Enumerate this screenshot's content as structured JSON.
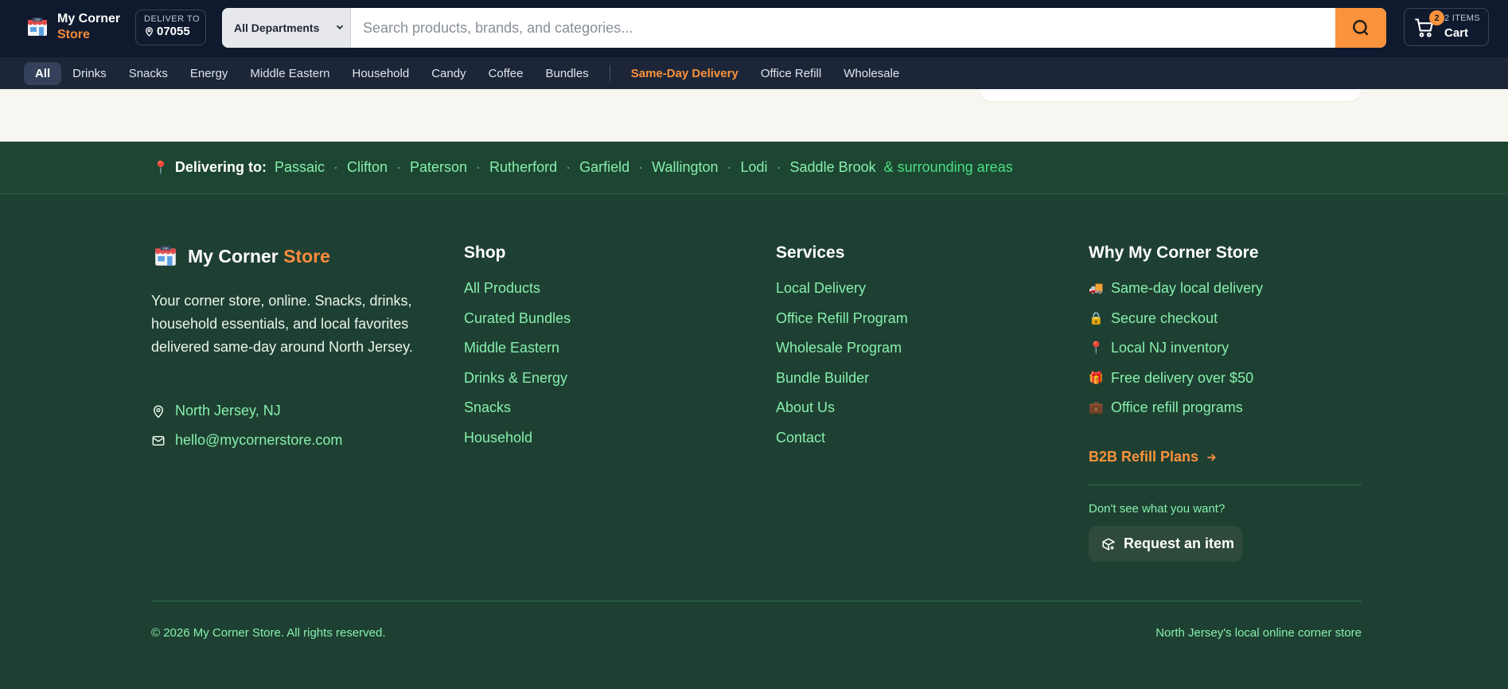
{
  "header": {
    "logo_line1": "My Corner",
    "logo_line2": "Store",
    "deliver_label": "DELIVER TO",
    "zip": "07055",
    "department": "All Departments",
    "search_placeholder": "Search products, brands, and categories...",
    "cart_count": "2",
    "cart_items": "2 ITEMS",
    "cart_label": "Cart"
  },
  "categories": [
    "All",
    "Drinks",
    "Snacks",
    "Energy",
    "Middle Eastern",
    "Household",
    "Candy",
    "Coffee",
    "Bundles"
  ],
  "services_nav": [
    "Same-Day Delivery",
    "Office Refill",
    "Wholesale"
  ],
  "delivery_strip": {
    "label": "Delivering to:",
    "towns": [
      "Passaic",
      "Clifton",
      "Paterson",
      "Rutherford",
      "Garfield",
      "Wallington",
      "Lodi",
      "Saddle Brook"
    ],
    "dot": "·",
    "suffix": "& surrounding areas"
  },
  "footer": {
    "brand_main": "My Corner ",
    "brand_accent": "Store",
    "tagline": "Your corner store, online. Snacks, drinks, household essentials, and local favorites delivered same-day around North Jersey.",
    "location": "North Jersey, NJ",
    "email": "hello@mycornerstore.com",
    "shop": {
      "heading": "Shop",
      "links": [
        "All Products",
        "Curated Bundles",
        "Middle Eastern",
        "Drinks & Energy",
        "Snacks",
        "Household"
      ]
    },
    "services": {
      "heading": "Services",
      "links": [
        "Local Delivery",
        "Office Refill Program",
        "Wholesale Program",
        "Bundle Builder",
        "About Us",
        "Contact"
      ]
    },
    "why": {
      "heading": "Why My Corner Store",
      "items": [
        {
          "emoji": "🚚",
          "text": "Same-day local delivery"
        },
        {
          "emoji": "🔒",
          "text": "Secure checkout"
        },
        {
          "emoji": "📍",
          "text": "Local NJ inventory"
        },
        {
          "emoji": "🎁",
          "text": "Free delivery over $50"
        },
        {
          "emoji": "💼",
          "text": "Office refill programs"
        }
      ],
      "b2b": "B2B Refill Plans",
      "dont_see": "Don't see what you want?",
      "request": "Request an item"
    },
    "copyright": "© 2026 My Corner Store. All rights reserved.",
    "slogan": "North Jersey's local online corner store"
  },
  "colors": {
    "header_bg": "#0f1a2e",
    "nav_bg": "#1c2638",
    "accent": "#fb923c",
    "footer_bg": "#1e4032",
    "link_green": "#86efac"
  },
  "icons": {
    "logo": "storefront-icon",
    "zip": "map-pin-icon",
    "search": "search-icon",
    "cart": "cart-icon",
    "location": "map-pin-icon",
    "email": "mail-icon",
    "b2b": "arrow-right-icon",
    "request": "package-plus-icon"
  }
}
